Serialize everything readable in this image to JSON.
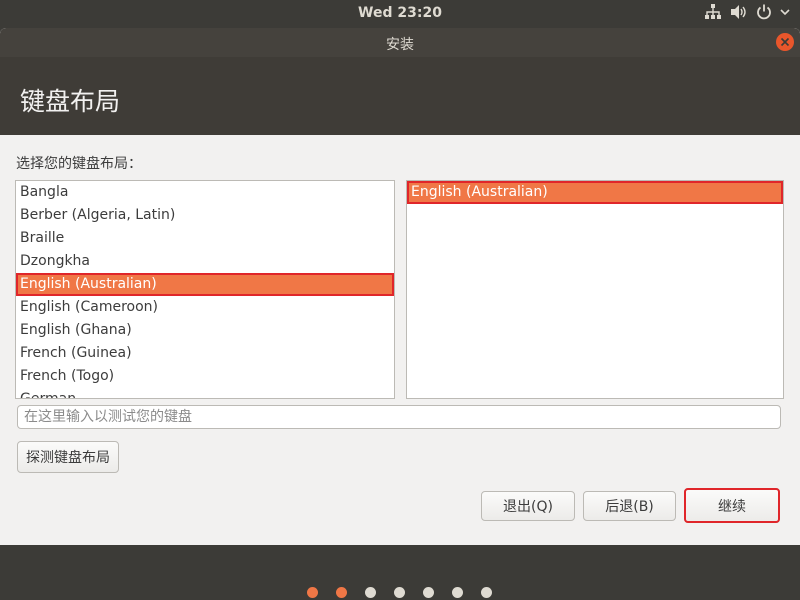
{
  "topbar": {
    "clock": "Wed 23:20",
    "icons": [
      "network-icon",
      "volume-icon",
      "power-icon",
      "chevron-down-icon"
    ]
  },
  "window": {
    "title": "安装",
    "close_icon": "close-icon"
  },
  "header": {
    "title": "键盘布局"
  },
  "main": {
    "prompt": "选择您的键盘布局：",
    "layouts": [
      {
        "label": "Bangla"
      },
      {
        "label": "Berber (Algeria, Latin)"
      },
      {
        "label": "Braille"
      },
      {
        "label": "Dzongkha"
      },
      {
        "label": "English (Australian)",
        "selected": true
      },
      {
        "label": "English (Cameroon)"
      },
      {
        "label": "English (Ghana)"
      },
      {
        "label": "French (Guinea)"
      },
      {
        "label": "French (Togo)"
      },
      {
        "label": "German"
      }
    ],
    "variants": [
      {
        "label": "English (Australian)",
        "selected": true
      }
    ],
    "test_input_placeholder": "在这里输入以测试您的键盘",
    "detect_button": "探测键盘布局"
  },
  "buttons": {
    "quit": "退出(Q)",
    "back": "后退(B)",
    "continue": "继续"
  },
  "progress": {
    "total_steps": 7,
    "completed_steps": 2
  },
  "colors": {
    "accent": "#f07746",
    "highlight_border": "#e0262a",
    "close_button": "#e9562b"
  }
}
